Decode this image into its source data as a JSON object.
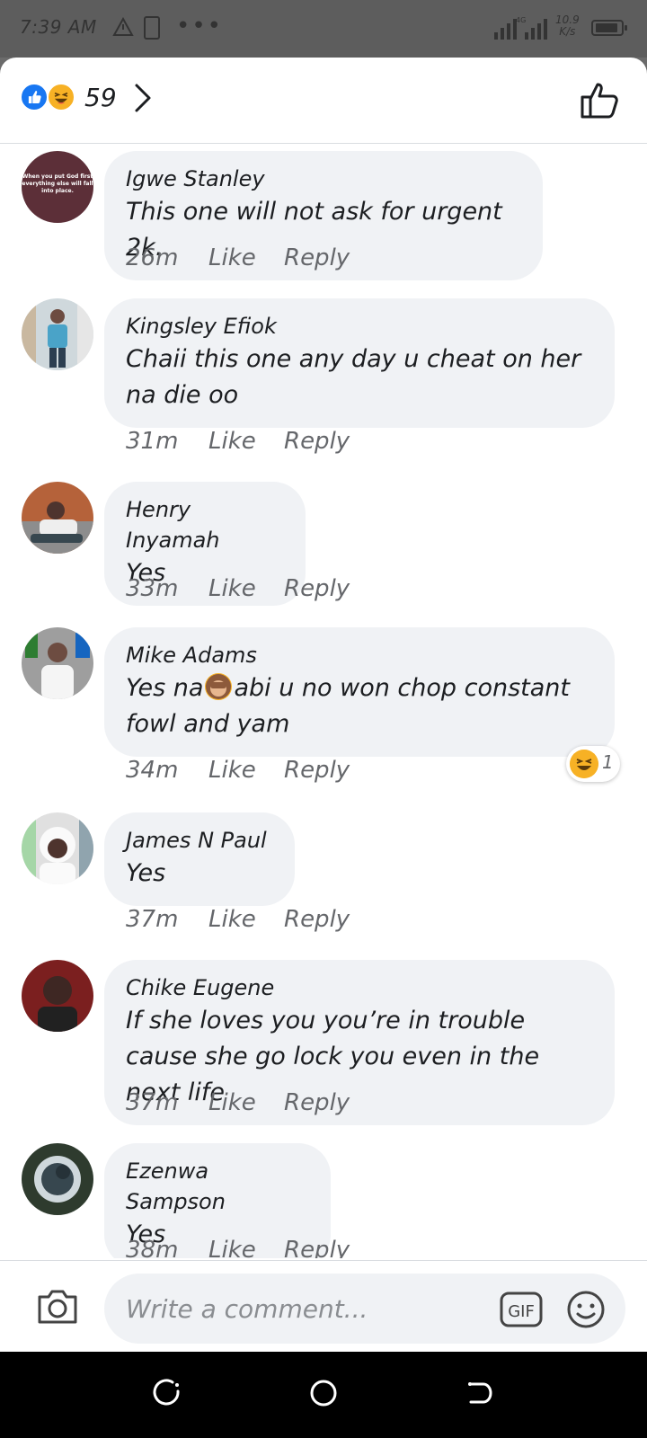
{
  "status_bar": {
    "time": "7:39 AM",
    "net_speed_value": "10.9",
    "net_speed_unit": "K/s",
    "network": "4G"
  },
  "header": {
    "reaction_count": "59",
    "reactions": [
      "like-icon",
      "haha-icon"
    ]
  },
  "comments": [
    {
      "author": "Igwe Stanley",
      "text": "This one will not ask for urgent 2k.",
      "time": "26m",
      "like": "Like",
      "reply": "Reply"
    },
    {
      "author": "Kingsley Efiok",
      "text": "Chaii this one any day u cheat on her na die oo",
      "time": "31m",
      "like": "Like",
      "reply": "Reply"
    },
    {
      "author": "Henry Inyamah",
      "text": "Yes",
      "time": "33m",
      "like": "Like",
      "reply": "Reply"
    },
    {
      "author": "Mike Adams",
      "text_before": "Yes na",
      "text_after": "abi u no won chop constant fowl and yam",
      "time": "34m",
      "like": "Like",
      "reply": "Reply",
      "reaction_count": "1"
    },
    {
      "author": "James N Paul",
      "text": "Yes",
      "time": "37m",
      "like": "Like",
      "reply": "Reply"
    },
    {
      "author": "Chike Eugene",
      "text": "If she loves you you’re in trouble cause she go lock you even in the next life",
      "time": "37m",
      "like": "Like",
      "reply": "Reply"
    },
    {
      "author": "Ezenwa Sampson",
      "text": "Yes",
      "time": "38m",
      "like": "Like",
      "reply": "Reply"
    }
  ],
  "avatar_1_caption": "When you put God first everything else will fall into place.",
  "composer": {
    "placeholder": "Write a comment...",
    "gif_label": "GIF"
  },
  "colors": {
    "bubble": "#f0f2f5",
    "like_blue": "#1877f2",
    "haha_yellow": "#f7b125",
    "meta_gray": "#65676b"
  }
}
